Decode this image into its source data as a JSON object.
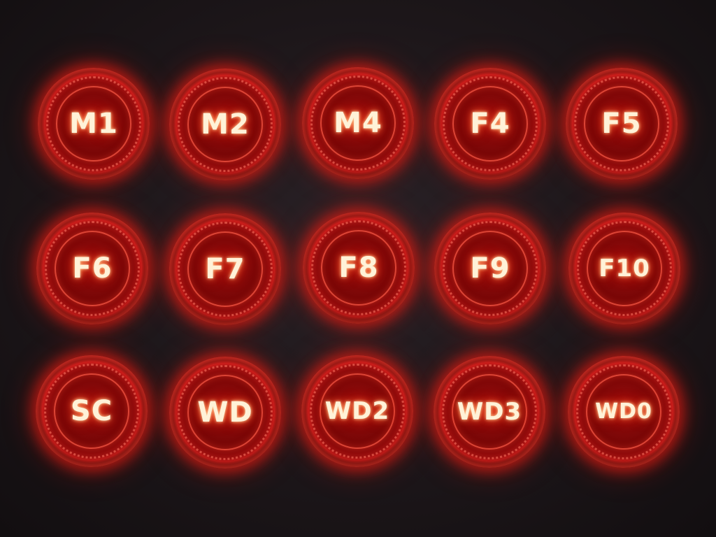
{
  "colors": {
    "background": "#1c1619",
    "button_glow": "#ff2a10",
    "label": "#fff2d8"
  },
  "buttons": [
    {
      "label": "M1"
    },
    {
      "label": "M2"
    },
    {
      "label": "M4"
    },
    {
      "label": "F4"
    },
    {
      "label": "F5"
    },
    {
      "label": "F6"
    },
    {
      "label": "F7"
    },
    {
      "label": "F8"
    },
    {
      "label": "F9"
    },
    {
      "label": "F10"
    },
    {
      "label": "SC"
    },
    {
      "label": "WD"
    },
    {
      "label": "WD2"
    },
    {
      "label": "WD3"
    },
    {
      "label": "WD0"
    }
  ]
}
